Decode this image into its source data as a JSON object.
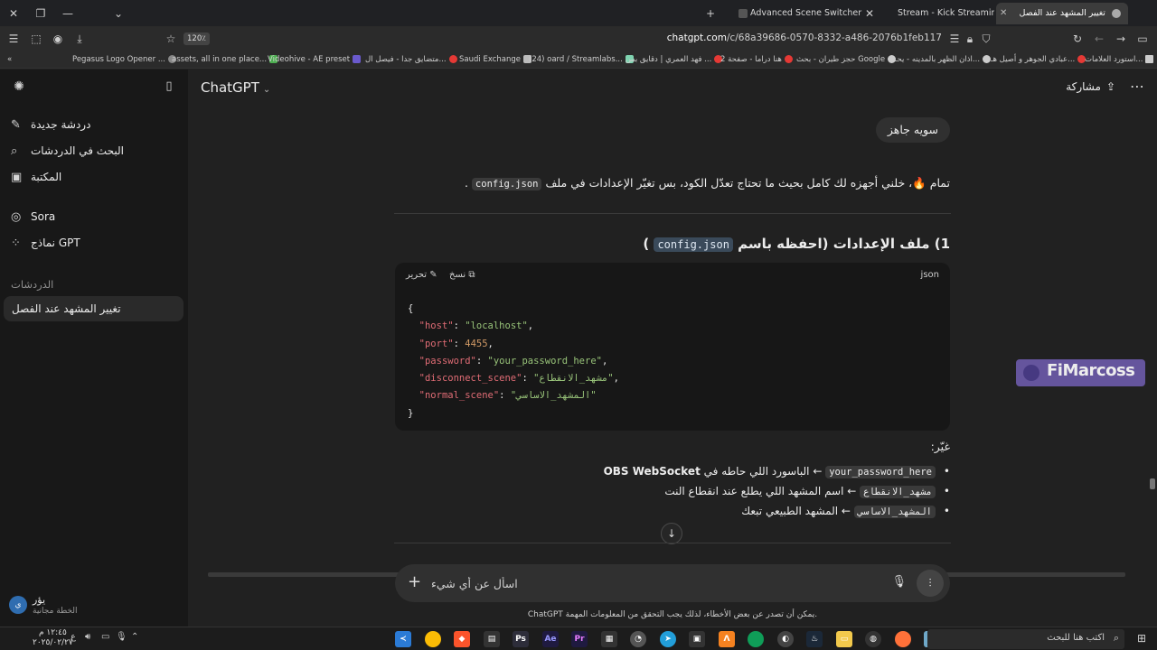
{
  "browser": {
    "tabs": [
      {
        "title": "تغيير المشهد عند الفصل",
        "active": true
      },
      {
        "title": "Stream - Kick Streaming",
        "active": false
      },
      {
        "title": "Advanced Scene Switcher - Re",
        "active": false
      }
    ],
    "zoom": "120٪",
    "url_host": "chatgpt.com",
    "url_path": "/c/68a39686-0570-8332-a486-2076b1feb117",
    "bookmarks": [
      "استورد العلامات...",
      "عبادي الجوهر و أصيل هـ...",
      "اذان الظهر بالمدينه - يحـ...",
      "حجز طيران - بحث Google",
      "هنا دراما - صفحة 2",
      "فهد العمري | دقايق بس ...",
      "(24) oard / Streamlabs...",
      "Saudi Exchange",
      "متضايق جدا - فيصل ال...",
      "Videohive - AE preset",
      "assets, all in one place...",
      "Pegasus Logo Opener ..."
    ]
  },
  "sidebar": {
    "items": [
      {
        "label": "دردشة جديدة",
        "icon": "edit-icon"
      },
      {
        "label": "البحث في الدردشات",
        "icon": "search-icon"
      },
      {
        "label": "المكتبة",
        "icon": "library-icon"
      },
      {
        "label": "Sora",
        "icon": "sora-icon"
      },
      {
        "label": "نماذج GPT",
        "icon": "gpt-grid-icon"
      }
    ],
    "section_title": "الدردشات",
    "chats": [
      "تغيير المشهد عند الفصل"
    ],
    "user": {
      "name": "يؤر",
      "plan": "الخطة مجانية",
      "initial": "ي"
    }
  },
  "header": {
    "model": "ChatGPT",
    "share": "مشاركة"
  },
  "conversation": {
    "user_message": "سويه جاهز",
    "intro_text": "تمام 🔥، خلني أجهزه لك كامل بحيث ما تحتاج تعدّل الكود، بس تغيّر الإعدادات في ملف",
    "intro_code": "config.json",
    "intro_end": ".",
    "heading_text": "1) ملف الإعدادات (احفظه باسم",
    "heading_code": "config.json",
    "heading_end": ")",
    "code_block": {
      "language": "json",
      "copy_label": "نسخ",
      "edit_label": "تحرير",
      "lines": {
        "open": "{",
        "host_key": "\"host\"",
        "host_val": "\"localhost\"",
        "port_key": "\"port\"",
        "port_val": "4455",
        "password_key": "\"password\"",
        "password_val": "\"your_password_here\"",
        "disconnect_key": "\"disconnect_scene\"",
        "disconnect_val": "\"مشهد_الانقطاع\"",
        "normal_key": "\"normal_scene\"",
        "normal_val": "\"المشهد_الاساسي\"",
        "close": "}"
      }
    },
    "change_title": "غيّر:",
    "bullets": [
      {
        "code": "your_password_here",
        "text": "← الباسورد اللي حاطه في",
        "bold": "OBS WebSocket"
      },
      {
        "code": "مشهد_الانقطاع",
        "text": "← اسم المشهد اللي يطلع عند انقطاع النت",
        "bold": ""
      },
      {
        "code": "المشهد_الاساسي",
        "text": "← المشهد الطبيعي تبعك",
        "bold": ""
      }
    ]
  },
  "composer": {
    "placeholder": "اسأل عن أي شيء",
    "disclaimer": "ChatGPT يمكن أن تصدر عن بعض الأخطاء، لذلك يجب التحقق من المعلومات المهمة."
  },
  "taskbar": {
    "search_placeholder": "اكتب هنا للبحث",
    "time": "١٢:٤٥ م",
    "date": "٢٠٢٥/٠٢/٢٧",
    "language": "ع"
  }
}
